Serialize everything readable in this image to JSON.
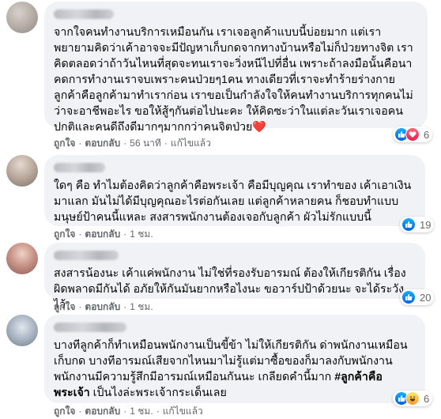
{
  "comments": [
    {
      "text": "จากใจคนทำงานบริการเหมือนกัน เราเจอลูกค้าแบบนี้บ่อยมาก แต่เราพยายามคิดว่าเค้าอาจจะมีปัญหาเก็บกดจากทางบ้านหรือไม่ก็ป่วยทางจิต เราคิดตลอดว่าถ้าวันไหนที่สุดจะทนเราจะวิ่งหนีไปที่อื่น เพราะถ้าลงมือนั้นคือนาคดการทำงานเราจบเพราะคนป่วยๆ1คน ทางเดียวที่เราจะทำร้ายร่างกายลูกค้าคือลูกค้ามาทำเราก่อน เราขอเป็นกำลังใจให้คนทำงานบริการทุกคนไม่ว่าจะอาชีพอะไร ขอให้สู้ๆกันต่อไปนะคะ ให้คิดซะว่าในแต่ละวันเราเจอคนปกติและคนดีถึงดีมากๆมากกว่าคนจิตป่วย❤️",
      "like": "ถูกใจ",
      "reply": "ตอบกลับ",
      "time": "56 นาที",
      "edited": "แก้ไขแล้ว",
      "reactions": [
        "like-icon",
        "love-icon"
      ],
      "count": "6"
    },
    {
      "text": "ใดๆ คือ ทำไมต้องคิดว่าลูกค้าคือพระเจ้า คือมีบุญคุณ เราทำของ เค้าเอาเงินมาแลก มันไม่ได้มีบุญคุณอะไรต่อกันเลย แต่ลูกค้าหลายคน ก็ชอบทำแบบมนุษย์ป้าคนนี้แหละ สงสารพนักงานต้องเจอกับลูกค้า ผัวไม่รักแบบนี้",
      "like": "ถูกใจ",
      "reply": "ตอบกลับ",
      "time": "1 ชม.",
      "reactions": [
        "like-icon"
      ],
      "count": "19"
    },
    {
      "text": "สงสารน้องนะ เค้าแค่พนักงาน ไม่ใช่ที่รองรับอารมณ์ ต้องให้เกียรติกัน เรื่องผิดพลาดมีกันได้ อภัยให้กันมันยากหรือไงนะ ขอวาร์ปป้าด้วยนะ จะได้ระวังไว้",
      "like": "ถูกใจ",
      "reply": "ตอบกลับ",
      "time": "1 ชม.",
      "reactions": [
        "like-icon"
      ],
      "count": "20"
    },
    {
      "text_before": "บางทีลูกค้าก็ทำเหมือนพนักงานเป็นขี้ข้า ไม่ให้เกียรติกัน ด่าพนักงานเหมือนเก็บกด บางทีอารมณ์เสียจากไหนมาไม่รู้แต่มาซื้อของก็มาลงกับพนักงาน พนักงานมีความรู้สึกมีอารมณ์เหมือนกันนะ เกลียดคำนี้มาก ",
      "hashtag": "#ลูกค้าคือพระเจ้า",
      "text_after": " เป็นไงล่ะพระเจ้ากระเด็นเลย",
      "like": "ถูกใจ",
      "reply": "ตอบกลับ",
      "time": "1 ชม.",
      "edited": "แก้ไขแล้ว",
      "reactions": [
        "like-icon",
        "haha-icon"
      ],
      "count": "6"
    }
  ],
  "colors": {
    "bubble": "#f0f2f5",
    "meta": "#65676b",
    "like": "#1877f2",
    "love": "#f33e58",
    "haha": "#f7b125"
  }
}
